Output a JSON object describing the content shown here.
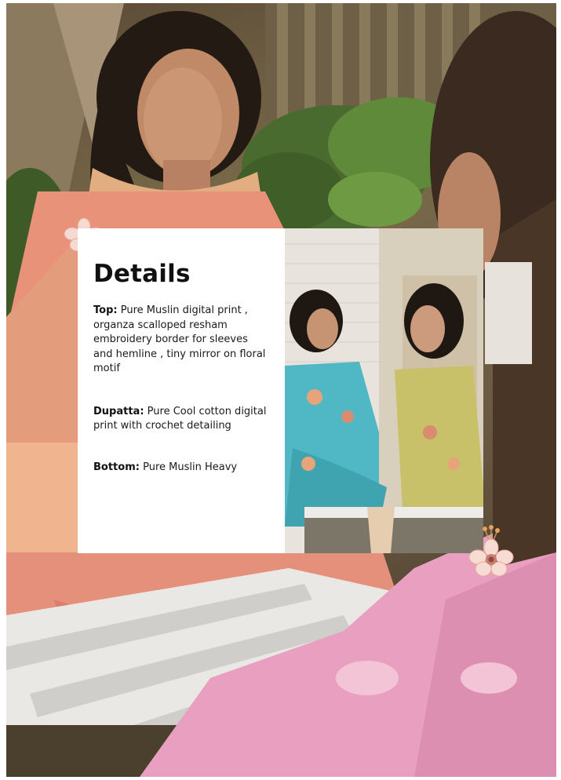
{
  "details": {
    "title": "Details",
    "top_label": "Top:",
    "top_text": "Pure Muslin digital print , organza scalloped resham embroidery border for sleeves and hemline , tiny mirror on floral motif",
    "dupatta_label": "Dupatta:",
    "dupatta_text": "Pure Cool cotton digital print with crochet detailing",
    "bottom_label": "Bottom:",
    "bottom_text": "Pure Muslin Heavy"
  },
  "colors": {
    "card_background": "#ffffff",
    "peach_outfit": "#e8927a",
    "pink_outfit": "#e9a0c0",
    "teal_outfit": "#4fb8c4",
    "olive_outfit": "#c9c06a"
  },
  "images": {
    "background_photo": "photo-of-two-women-on-bench",
    "inset_photo": "photo-of-two-women-in-teal-and-olive-suits"
  }
}
